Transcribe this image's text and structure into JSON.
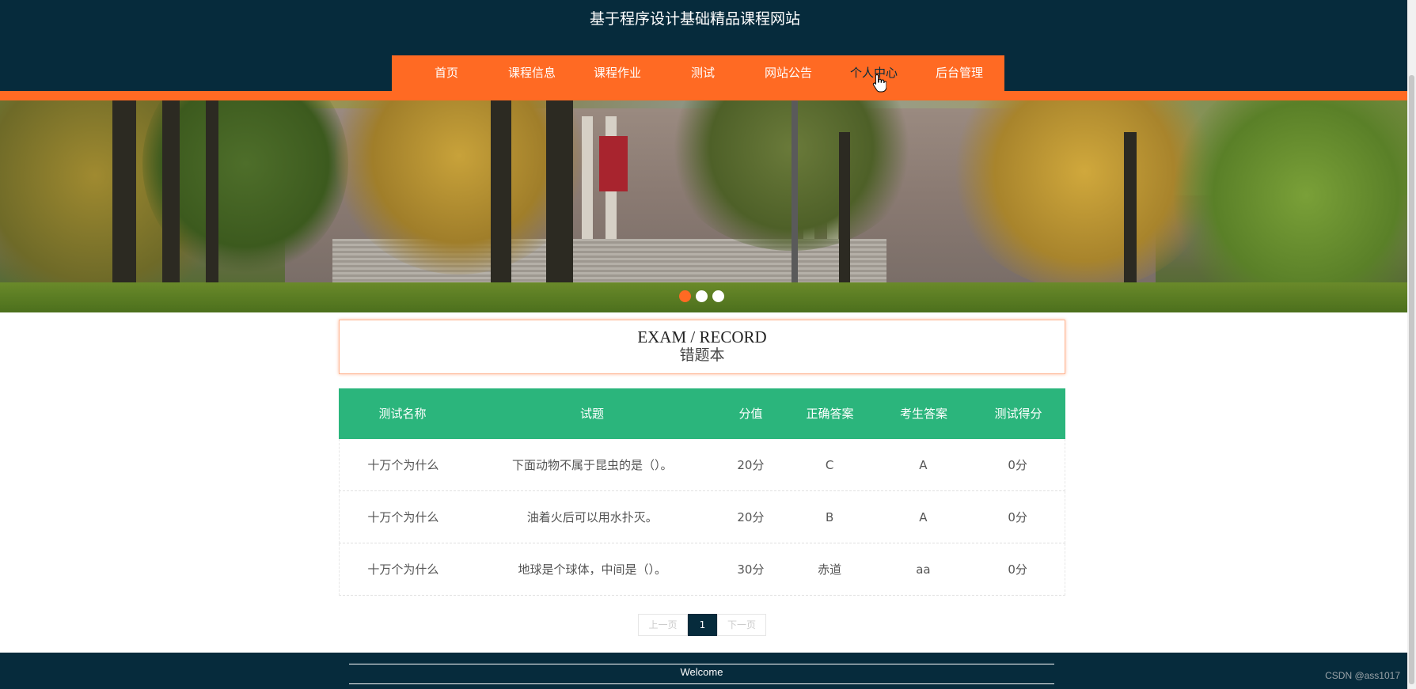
{
  "header": {
    "site_title": "基于程序设计基础精品课程网站"
  },
  "nav": {
    "items": [
      {
        "label": "首页"
      },
      {
        "label": "课程信息"
      },
      {
        "label": "课程作业"
      },
      {
        "label": "测试"
      },
      {
        "label": "网站公告"
      },
      {
        "label": "个人中心"
      },
      {
        "label": "后台管理"
      }
    ],
    "hovered": "个人中心"
  },
  "banner": {
    "slide_count": 3,
    "active_slide": 1
  },
  "section": {
    "title_en": "EXAM / RECORD",
    "title_cn": "错题本"
  },
  "table": {
    "headers": [
      "测试名称",
      "试题",
      "分值",
      "正确答案",
      "考生答案",
      "测试得分"
    ],
    "rows": [
      [
        "十万个为什么",
        "下面动物不属于昆虫的是（）。",
        "20分",
        "C",
        "A",
        "0分"
      ],
      [
        "十万个为什么",
        "油着火后可以用水扑灭。",
        "20分",
        "B",
        "A",
        "0分"
      ],
      [
        "十万个为什么",
        "地球是个球体，中间是（）。",
        "30分",
        "赤道",
        "aa",
        "0分"
      ]
    ]
  },
  "pagination": {
    "prev_label": "上一页",
    "current_page": "1",
    "next_label": "下一页"
  },
  "footer": {
    "text": "Welcome"
  },
  "watermark": "CSDN @ass1017",
  "colors": {
    "header_bg": "#062b3c",
    "accent_orange": "#ff6a23",
    "table_header_green": "#2bb57c"
  }
}
